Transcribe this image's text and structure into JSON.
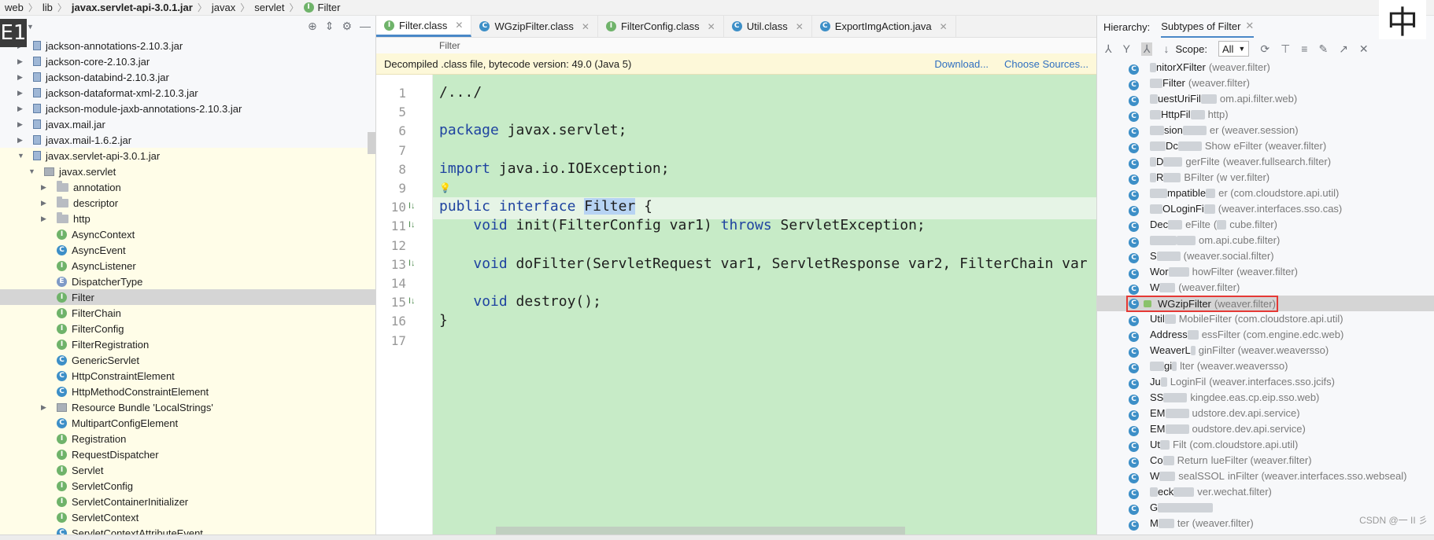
{
  "breadcrumb": [
    "web",
    "lib",
    "javax.servlet-api-3.0.1.jar",
    "javax",
    "servlet",
    "Filter"
  ],
  "project": {
    "title": "ect",
    "badge": "E1",
    "items": [
      {
        "label": "jackson-annotations-2.10.3.jar",
        "kind": "jar",
        "depth": 1,
        "arrow": "▶"
      },
      {
        "label": "jackson-core-2.10.3.jar",
        "kind": "jar",
        "depth": 1,
        "arrow": "▶"
      },
      {
        "label": "jackson-databind-2.10.3.jar",
        "kind": "jar",
        "depth": 1,
        "arrow": "▶"
      },
      {
        "label": "jackson-dataformat-xml-2.10.3.jar",
        "kind": "jar",
        "depth": 1,
        "arrow": "▶"
      },
      {
        "label": "jackson-module-jaxb-annotations-2.10.3.jar",
        "kind": "jar",
        "depth": 1,
        "arrow": "▶"
      },
      {
        "label": "javax.mail.jar",
        "kind": "jar",
        "depth": 1,
        "arrow": "▶"
      },
      {
        "label": "javax.mail-1.6.2.jar",
        "kind": "jar",
        "depth": 1,
        "arrow": "▶"
      },
      {
        "label": "javax.servlet-api-3.0.1.jar",
        "kind": "jar",
        "depth": 1,
        "arrow": "▼",
        "hl": true
      },
      {
        "label": "javax.servlet",
        "kind": "pkg",
        "depth": 2,
        "arrow": "▼",
        "hl": true
      },
      {
        "label": "annotation",
        "kind": "folder",
        "depth": 3,
        "arrow": "▶",
        "hl": true
      },
      {
        "label": "descriptor",
        "kind": "folder",
        "depth": 3,
        "arrow": "▶",
        "hl": true
      },
      {
        "label": "http",
        "kind": "folder",
        "depth": 3,
        "arrow": "▶",
        "hl": true
      },
      {
        "label": "AsyncContext",
        "kind": "i",
        "depth": 3,
        "hl": true
      },
      {
        "label": "AsyncEvent",
        "kind": "c",
        "depth": 3,
        "hl": true
      },
      {
        "label": "AsyncListener",
        "kind": "i",
        "depth": 3,
        "hl": true
      },
      {
        "label": "DispatcherType",
        "kind": "e",
        "depth": 3,
        "hl": true
      },
      {
        "label": "Filter",
        "kind": "i",
        "depth": 3,
        "sel": true
      },
      {
        "label": "FilterChain",
        "kind": "i",
        "depth": 3,
        "hl": true
      },
      {
        "label": "FilterConfig",
        "kind": "i",
        "depth": 3,
        "hl": true
      },
      {
        "label": "FilterRegistration",
        "kind": "i",
        "depth": 3,
        "hl": true
      },
      {
        "label": "GenericServlet",
        "kind": "c",
        "depth": 3,
        "hl": true
      },
      {
        "label": "HttpConstraintElement",
        "kind": "c",
        "depth": 3,
        "hl": true
      },
      {
        "label": "HttpMethodConstraintElement",
        "kind": "c",
        "depth": 3,
        "hl": true
      },
      {
        "label": "Resource Bundle 'LocalStrings'",
        "kind": "bundle",
        "depth": 3,
        "arrow": "▶",
        "hl": true
      },
      {
        "label": "MultipartConfigElement",
        "kind": "c",
        "depth": 3,
        "hl": true
      },
      {
        "label": "Registration",
        "kind": "i",
        "depth": 3,
        "hl": true
      },
      {
        "label": "RequestDispatcher",
        "kind": "i",
        "depth": 3,
        "hl": true
      },
      {
        "label": "Servlet",
        "kind": "i",
        "depth": 3,
        "hl": true
      },
      {
        "label": "ServletConfig",
        "kind": "i",
        "depth": 3,
        "hl": true
      },
      {
        "label": "ServletContainerInitializer",
        "kind": "i",
        "depth": 3,
        "hl": true
      },
      {
        "label": "ServletContext",
        "kind": "i",
        "depth": 3,
        "hl": true
      },
      {
        "label": "ServletContextAttributeEvent",
        "kind": "c",
        "depth": 3,
        "hl": true
      }
    ]
  },
  "editor": {
    "tabs": [
      {
        "label": "Filter.class",
        "kind": "i",
        "active": true
      },
      {
        "label": "WGzipFilter.class",
        "kind": "c"
      },
      {
        "label": "FilterConfig.class",
        "kind": "i"
      },
      {
        "label": "Util.class",
        "kind": "c"
      },
      {
        "label": "ExportImgAction.java",
        "kind": "c"
      }
    ],
    "subcrumb": "Filter",
    "banner": {
      "text": "Decompiled .class file, bytecode version: 49.0 (Java 5)",
      "download": "Download...",
      "sources": "Choose Sources..."
    },
    "lines": [
      {
        "n": "1",
        "text": "/.../"
      },
      {
        "n": "5",
        "text": ""
      },
      {
        "n": "6",
        "text": "package javax.servlet;"
      },
      {
        "n": "7",
        "text": ""
      },
      {
        "n": "8",
        "text": "import java.io.IOException;"
      },
      {
        "n": "9",
        "text": ""
      },
      {
        "n": "10",
        "text": "public interface Filter {"
      },
      {
        "n": "11",
        "text": "    void init(FilterConfig var1) throws ServletException;"
      },
      {
        "n": "12",
        "text": ""
      },
      {
        "n": "13",
        "text": "    void doFilter(ServletRequest var1, ServletResponse var2, FilterChain var"
      },
      {
        "n": "14",
        "text": ""
      },
      {
        "n": "15",
        "text": "    void destroy();"
      },
      {
        "n": "16",
        "text": "}"
      },
      {
        "n": "17",
        "text": ""
      }
    ]
  },
  "hierarchy": {
    "label": "Hierarchy:",
    "subtab": "Subtypes of Filter",
    "scope_label": "Scope:",
    "scope_value": "All",
    "items": [
      {
        "pre": 8,
        "name": "nitorXFilter",
        "pkg": "(weaver.filter)"
      },
      {
        "pre": 16,
        "name": "Filter",
        "pkg": "(weaver.filter)"
      },
      {
        "pre": 10,
        "name": "uestUriFil",
        "mid": 20,
        "pkg": "om.api.filter.web)"
      },
      {
        "pre": 14,
        "name": "HttpFil",
        "mid": 18,
        "pkg": "http)"
      },
      {
        "pre": 18,
        "name": "sion",
        "mid": 30,
        "pkg": "er (weaver.session)"
      },
      {
        "pre": 20,
        "name": "Dc",
        "mid": 30,
        "pkg": "Show",
        "post": "eFilter (weaver.filter)"
      },
      {
        "pre": 8,
        "name": "D",
        "mid": 24,
        "pkg": "gerFilte",
        "post": "(weaver.fullsearch.filter)"
      },
      {
        "pre": 8,
        "name": "R",
        "mid": 22,
        "pkg": "BFilter (w",
        "post": "ver.filter)"
      },
      {
        "pre": 22,
        "name": "mpatible",
        "mid": 12,
        "pkg": "er (com.cloudstore.api.util)"
      },
      {
        "pre": 16,
        "name": "OLoginFi",
        "mid": 14,
        "pkg": "(weaver.interfaces.sso.cas)"
      },
      {
        "pre": 0,
        "name": "Dec",
        "mid": 18,
        "pkg": "eFilte",
        "post": "(",
        "post2": "cube.filter)"
      },
      {
        "pre": 34,
        "name": "",
        "mid": 24,
        "pkg": "om.api.cube.filter)"
      },
      {
        "pre": 0,
        "name": "S",
        "mid": 30,
        "pkg": "(weaver.social.filter)"
      },
      {
        "pre": 0,
        "name": "Wor",
        "mid": 26,
        "pkg": "howFilter (weaver.filter)"
      },
      {
        "pre": 0,
        "name": "W",
        "mid": 20,
        "pkg": "(weaver.filter)"
      },
      {
        "pre": 0,
        "name": "WGzipFilter",
        "pkg": "(weaver.filter)",
        "selected": true
      },
      {
        "pre": 0,
        "name": "Util",
        "mid": 14,
        "pkg": "MobileFilter (com.cloudstore.api.util)"
      },
      {
        "pre": 0,
        "name": "Address",
        "mid": 14,
        "pkg": "essFilter (com.engine.edc.web)"
      },
      {
        "pre": 0,
        "name": "WeaverL",
        "mid": 6,
        "pkg": "ginFilter (weaver.weaversso)"
      },
      {
        "pre": 18,
        "name": "gi",
        "mid": 6,
        "pkg": "lter (weaver.weaversso)"
      },
      {
        "pre": 0,
        "name": "Ju",
        "mid": 8,
        "pkg": "LoginFil",
        "post": "(weaver.interfaces.sso.jcifs)"
      },
      {
        "pre": 0,
        "name": "SS",
        "mid": 30,
        "pkg": "kingdee.eas.cp.eip.sso.web)"
      },
      {
        "pre": 0,
        "name": "EM",
        "mid": 30,
        "pkg": "udstore.dev.api.service)"
      },
      {
        "pre": 0,
        "name": "EM",
        "mid": 30,
        "pkg": "oudstore.dev.api.service)"
      },
      {
        "pre": 0,
        "name": "Ut",
        "mid": 12,
        "pkg": "Filt",
        "post": "(com.cloudstore.api.util)"
      },
      {
        "pre": 0,
        "name": "Co",
        "mid": 14,
        "pkg": "Return",
        "post": "lueFilter (weaver.filter)"
      },
      {
        "pre": 0,
        "name": "W",
        "mid": 20,
        "pkg": "sealSSOL",
        "post": "inFilter (weaver.interfaces.sso.webseal)"
      },
      {
        "pre": 10,
        "name": "eck",
        "mid": 26,
        "pkg": "ver.wechat.filter)"
      },
      {
        "pre": 0,
        "name": "G",
        "mid": 70,
        "pkg": ""
      },
      {
        "pre": 0,
        "name": "M",
        "mid": 20,
        "pkg": "ter (weaver.filter)"
      }
    ]
  },
  "ime": "中",
  "watermark": "CSDN @一 II 彡"
}
